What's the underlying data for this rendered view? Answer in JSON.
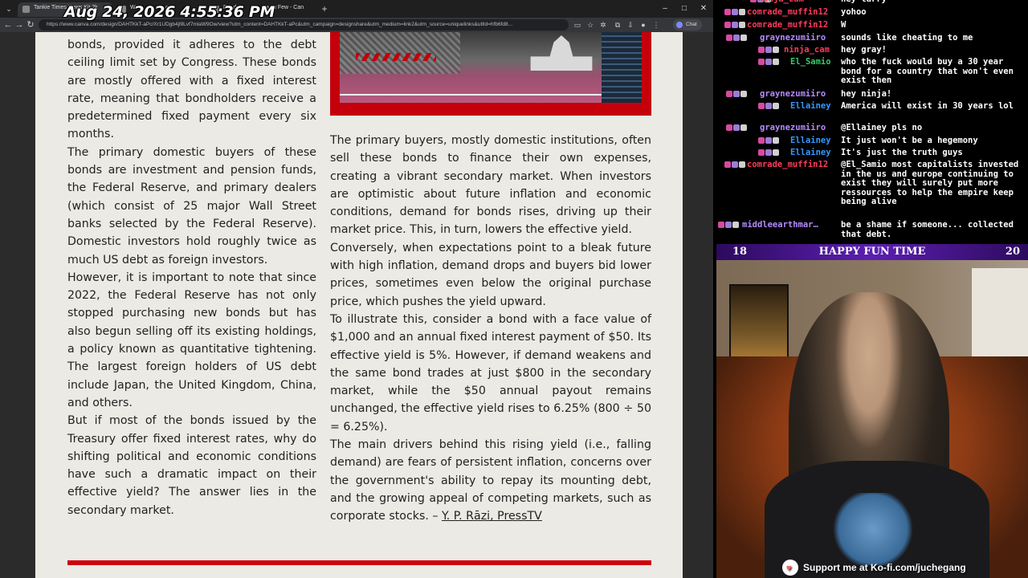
{
  "overlay": {
    "datetime": "Aug 24, 2026 4:55:36 PM"
  },
  "browser": {
    "tabs": [
      {
        "label": "Tankie Times News Kit 2k",
        "active": true
      },
      {
        "label": "Wo",
        "active": false
      },
      {
        "label": "",
        "active": false
      },
      {
        "label": "Bonds",
        "active": false
      },
      {
        "label": "u Few - Can",
        "active": false
      }
    ],
    "url": "https://www.canva.com/design/DAHTKkT-aPc/Xr1UDgb4jl9Lvf7mlaW9Ow/view?utm_content=DAHTKkT-aPc&utm_campaign=designshare&utm_medium=link2&utm_source=uniquelinks&utlId=hfb6fd8...",
    "chat_button": "Chat",
    "icons": {
      "tab_list": "chevron-down-icon",
      "new_tab": "plus-icon"
    }
  },
  "article": {
    "left_paragraphs": [
      "bonds, provided it adheres to the debt ceiling limit set by Congress. These bonds are mostly offered with a fixed interest rate, meaning that bondholders receive a predetermined fixed payment every six months.",
      "The primary domestic buyers of these bonds are investment and pension funds, the Federal Reserve, and primary dealers (which consist of 25 major Wall Street banks selected by the Federal Reserve). Domestic investors hold roughly twice as much US debt as foreign investors.",
      "However, it is important to note that since 2022, the Federal Reserve has not only stopped purchasing new bonds but has also begun selling off its existing holdings, a policy known as quantitative tightening. The largest foreign holders of US debt include Japan, the United Kingdom, China, and others.",
      "But if most of the bonds issued by the Treasury offer fixed interest rates, why do shifting political and economic conditions have such a dramatic impact on their effective yield? The answer lies in the secondary market."
    ],
    "right_paragraphs": [
      "The primary buyers, mostly domestic institutions, often sell these bonds to finance their own expenses, creating a vibrant secondary market. When investors are optimistic about future inflation and economic conditions, demand for bonds rises, driving up their market price. This, in turn, lowers the effective yield.",
      "Conversely, when expectations point to a bleak future with high inflation, demand drops and buyers bid lower prices, sometimes even below the original purchase price, which pushes the yield upward.",
      "To illustrate this, consider a bond with a face value of $1,000 and an annual fixed interest payment of $50. Its effective yield is 5%. However, if demand weakens and the same bond trades at just $800 in the secondary market, while the $50 annual payout remains unchanged, the effective yield rises to 6.25% (800 ÷ 50 = 6.25%)."
    ],
    "closing_paragraph": "The main drivers behind this rising yield (i.e., falling demand) are fears of persistent inflation, concerns over the government's ability to repay its mounting debt, and the growing appeal of competing markets, such as corporate stocks. – ",
    "source_link": "Y. P. Rāzi, PressTV"
  },
  "chat": {
    "messages": [
      {
        "user": "ninja_cam",
        "text": "hey larry",
        "color": "#ff3b5c"
      },
      {
        "user": "comrade_muffin12",
        "text": "yohoo",
        "color": "#ff3b5c"
      },
      {
        "user": "comrade_muffin12",
        "text": "W",
        "color": "#ff3b5c"
      },
      {
        "user": "graynezumiiro",
        "text": "sounds like cheating to me",
        "color": "#b48cff"
      },
      {
        "user": "ninja_cam",
        "text": "hey gray!",
        "color": "#ff3b5c"
      },
      {
        "user": "El_Samio",
        "text": "who the fuck would buy a 30 year bond for a country that won't even exist then",
        "color": "#33cc66"
      },
      {
        "user": "graynezumiiro",
        "text": "hey ninja!",
        "color": "#b48cff"
      },
      {
        "user": "Ellainey",
        "text": "America will exist in 30 years lol",
        "color": "#3399ff"
      },
      {
        "user": "graynezumiiro",
        "text": "@Ellainey pls no",
        "color": "#b48cff"
      },
      {
        "user": "Ellainey",
        "text": "It just won't be a hegemony",
        "color": "#3399ff"
      },
      {
        "user": "Ellainey",
        "text": "It's just the truth guys",
        "color": "#3399ff"
      },
      {
        "user": "comrade_muffin12",
        "text": "@El_Samio most capitalists invested in the us and europe continuing to exist they will surely put more ressources to help the empire keep being alive",
        "color": "#ff3b5c"
      },
      {
        "user": "middleearthmar…",
        "text": "be a shame if someone... collected that debt.",
        "color": "#b48cff"
      }
    ]
  },
  "game_bar": {
    "left": "18",
    "title": "HAPPY FUN TIME",
    "right": "20"
  },
  "kofi": {
    "text": "Support me at Ko-fi.com/juchegang"
  }
}
